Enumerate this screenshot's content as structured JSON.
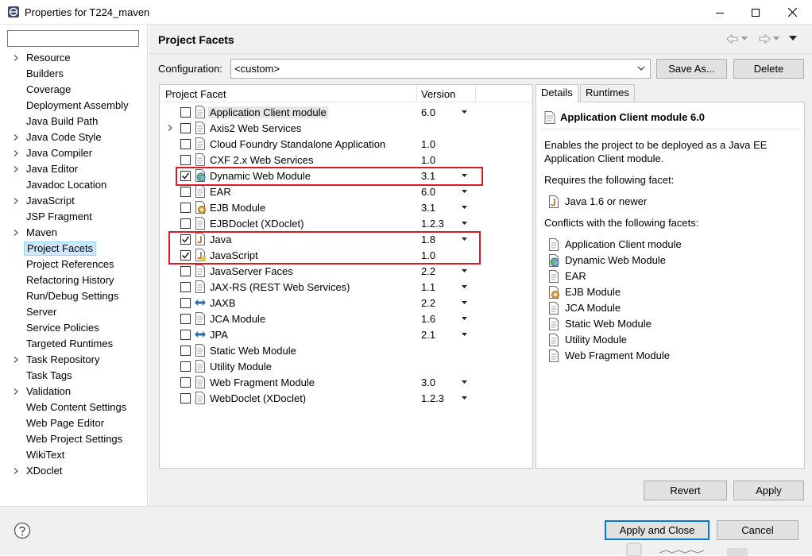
{
  "window": {
    "title": "Properties for T224_maven",
    "controls": [
      "minimize-icon",
      "maximize-icon",
      "close-icon"
    ]
  },
  "filter": {
    "value": "",
    "placeholder": ""
  },
  "nav": {
    "items": [
      {
        "label": "Resource",
        "expandable": true
      },
      {
        "label": "Builders",
        "expandable": false
      },
      {
        "label": "Coverage",
        "expandable": false
      },
      {
        "label": "Deployment Assembly",
        "expandable": false
      },
      {
        "label": "Java Build Path",
        "expandable": false
      },
      {
        "label": "Java Code Style",
        "expandable": true
      },
      {
        "label": "Java Compiler",
        "expandable": true
      },
      {
        "label": "Java Editor",
        "expandable": true
      },
      {
        "label": "Javadoc Location",
        "expandable": false
      },
      {
        "label": "JavaScript",
        "expandable": true
      },
      {
        "label": "JSP Fragment",
        "expandable": false
      },
      {
        "label": "Maven",
        "expandable": true
      },
      {
        "label": "Project Facets",
        "expandable": false,
        "selected": true
      },
      {
        "label": "Project References",
        "expandable": false
      },
      {
        "label": "Refactoring History",
        "expandable": false
      },
      {
        "label": "Run/Debug Settings",
        "expandable": false
      },
      {
        "label": "Server",
        "expandable": false
      },
      {
        "label": "Service Policies",
        "expandable": false
      },
      {
        "label": "Targeted Runtimes",
        "expandable": false
      },
      {
        "label": "Task Repository",
        "expandable": true
      },
      {
        "label": "Task Tags",
        "expandable": false
      },
      {
        "label": "Validation",
        "expandable": true
      },
      {
        "label": "Web Content Settings",
        "expandable": false
      },
      {
        "label": "Web Page Editor",
        "expandable": false
      },
      {
        "label": "Web Project Settings",
        "expandable": false
      },
      {
        "label": "WikiText",
        "expandable": false
      },
      {
        "label": "XDoclet",
        "expandable": true
      }
    ]
  },
  "header": {
    "title": "Project Facets",
    "nav_icons": [
      "back-icon",
      "back-menu-icon",
      "forward-icon",
      "forward-menu-icon",
      "view-menu-icon"
    ]
  },
  "configuration": {
    "label": "Configuration:",
    "value": "<custom>",
    "save_as": "Save As...",
    "delete": "Delete"
  },
  "facets": {
    "col_facet": "Project Facet",
    "col_version": "Version",
    "rows": [
      {
        "name": "Application Client module",
        "version": "6.0",
        "checked": false,
        "dropdown": true,
        "icon": "module-icon",
        "highlighted": true,
        "expandable": false
      },
      {
        "name": "Axis2 Web Services",
        "version": "",
        "checked": false,
        "dropdown": false,
        "icon": "module-icon",
        "expandable": true
      },
      {
        "name": "Cloud Foundry Standalone Application",
        "version": "1.0",
        "checked": false,
        "dropdown": false,
        "icon": "module-icon",
        "expandable": false
      },
      {
        "name": "CXF 2.x Web Services",
        "version": "1.0",
        "checked": false,
        "dropdown": false,
        "icon": "module-icon",
        "expandable": false
      },
      {
        "name": "Dynamic Web Module",
        "version": "3.1",
        "checked": true,
        "dropdown": true,
        "icon": "web-module-icon",
        "expandable": false
      },
      {
        "name": "EAR",
        "version": "6.0",
        "checked": false,
        "dropdown": true,
        "icon": "module-icon",
        "expandable": false
      },
      {
        "name": "EJB Module",
        "version": "3.1",
        "checked": false,
        "dropdown": true,
        "icon": "ejb-icon",
        "expandable": false
      },
      {
        "name": "EJBDoclet (XDoclet)",
        "version": "1.2.3",
        "checked": false,
        "dropdown": true,
        "icon": "module-icon",
        "expandable": false
      },
      {
        "name": "Java",
        "version": "1.8",
        "checked": true,
        "dropdown": true,
        "icon": "java-icon",
        "expandable": false
      },
      {
        "name": "JavaScript",
        "version": "1.0",
        "checked": true,
        "dropdown": false,
        "icon": "javascript-icon",
        "expandable": false
      },
      {
        "name": "JavaServer Faces",
        "version": "2.2",
        "checked": false,
        "dropdown": true,
        "icon": "module-icon",
        "expandable": false
      },
      {
        "name": "JAX-RS (REST Web Services)",
        "version": "1.1",
        "checked": false,
        "dropdown": true,
        "icon": "module-icon",
        "expandable": false
      },
      {
        "name": "JAXB",
        "version": "2.2",
        "checked": false,
        "dropdown": true,
        "icon": "arrows-icon",
        "expandable": false
      },
      {
        "name": "JCA Module",
        "version": "1.6",
        "checked": false,
        "dropdown": true,
        "icon": "module-icon",
        "expandable": false
      },
      {
        "name": "JPA",
        "version": "2.1",
        "checked": false,
        "dropdown": true,
        "icon": "arrows-icon",
        "expandable": false
      },
      {
        "name": "Static Web Module",
        "version": "",
        "checked": false,
        "dropdown": false,
        "icon": "module-icon",
        "expandable": false
      },
      {
        "name": "Utility Module",
        "version": "",
        "checked": false,
        "dropdown": false,
        "icon": "module-icon",
        "expandable": false
      },
      {
        "name": "Web Fragment Module",
        "version": "3.0",
        "checked": false,
        "dropdown": true,
        "icon": "module-icon",
        "expandable": false
      },
      {
        "name": "WebDoclet (XDoclet)",
        "version": "1.2.3",
        "checked": false,
        "dropdown": true,
        "icon": "module-icon",
        "expandable": false
      }
    ]
  },
  "details": {
    "tabs": [
      "Details",
      "Runtimes"
    ],
    "title": "Application Client module 6.0",
    "description_line1": "Enables the project to be deployed as a Java EE",
    "description_line2": "Application Client module.",
    "requires_label": "Requires the following facet:",
    "requires": [
      {
        "name": "Java 1.6 or newer",
        "icon": "java-icon"
      }
    ],
    "conflicts_label": "Conflicts with the following facets:",
    "conflicts": [
      {
        "name": "Application Client module",
        "icon": "module-icon"
      },
      {
        "name": "Dynamic Web Module",
        "icon": "web-module-icon"
      },
      {
        "name": "EAR",
        "icon": "module-icon"
      },
      {
        "name": "EJB Module",
        "icon": "ejb-icon"
      },
      {
        "name": "JCA Module",
        "icon": "module-icon"
      },
      {
        "name": "Static Web Module",
        "icon": "module-icon"
      },
      {
        "name": "Utility Module",
        "icon": "module-icon"
      },
      {
        "name": "Web Fragment Module",
        "icon": "module-icon"
      }
    ]
  },
  "actions": {
    "revert": "Revert",
    "apply": "Apply",
    "apply_and_close": "Apply and Close",
    "cancel": "Cancel"
  },
  "colors": {
    "highlight_border": "#d91c24",
    "selection_bg": "#cde8ff",
    "primary_border": "#0078d7"
  }
}
